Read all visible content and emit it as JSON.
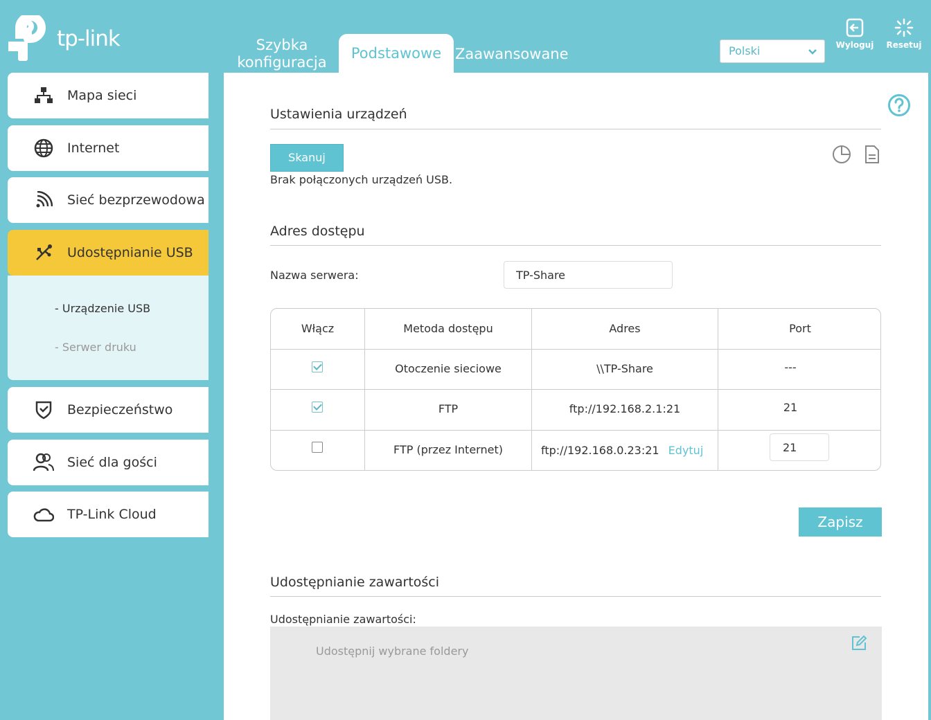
{
  "brand": {
    "name": "tp-link",
    "accent_color": "#5fc3d2",
    "background_color": "#72c7d5",
    "highlight_color": "#f5c839"
  },
  "header": {
    "tabs": [
      {
        "label_line1": "Szybka",
        "label_line2": "konfiguracja"
      },
      {
        "label": "Podstawowe",
        "active": true
      },
      {
        "label": "Zaawansowane"
      }
    ],
    "language": {
      "selected": "Polski"
    },
    "logout_label": "Wyloguj",
    "reset_label": "Resetuj"
  },
  "sidebar": {
    "items": [
      {
        "label": "Mapa sieci",
        "icon": "network-map-icon"
      },
      {
        "label": "Internet",
        "icon": "globe-icon"
      },
      {
        "label": "Sieć bezprzewodowa",
        "icon": "wireless-icon"
      },
      {
        "label": "Udostępnianie USB",
        "icon": "usb-icon",
        "active": true
      },
      {
        "label": "Bezpieczeństwo",
        "icon": "shield-icon"
      },
      {
        "label": "Sieć dla gości",
        "icon": "guests-icon"
      },
      {
        "label": "TP-Link Cloud",
        "icon": "cloud-icon"
      }
    ],
    "submenu": [
      {
        "label": "- Urządzenie USB",
        "current": true
      },
      {
        "label": "- Serwer druku"
      }
    ]
  },
  "devices": {
    "title": "Ustawienia urządzeń",
    "scan_label": "Skanuj",
    "status": "Brak połączonych urządzeń USB."
  },
  "access": {
    "title": "Adres dostępu",
    "server_label": "Nazwa serwera:",
    "server_value": "TP-Share",
    "columns": [
      "Włącz",
      "Metoda dostępu",
      "Adres",
      "Port"
    ],
    "rows": [
      {
        "enabled": true,
        "method": "Otoczenie sieciowe",
        "address": "\\\\TP-Share",
        "port": "---"
      },
      {
        "enabled": true,
        "method": "FTP",
        "address": "ftp://192.168.2.1:21",
        "port": "21"
      },
      {
        "enabled": false,
        "method": "FTP (przez Internet)",
        "address": "ftp://192.168.0.23:21",
        "edit_label": "Edytuj",
        "port": "21"
      }
    ],
    "save_label": "Zapisz"
  },
  "content_sharing": {
    "title": "Udostępnianie zawartości",
    "label": "Udostępnianie zawartości:",
    "placeholder": "Udostępnij wybrane foldery"
  }
}
